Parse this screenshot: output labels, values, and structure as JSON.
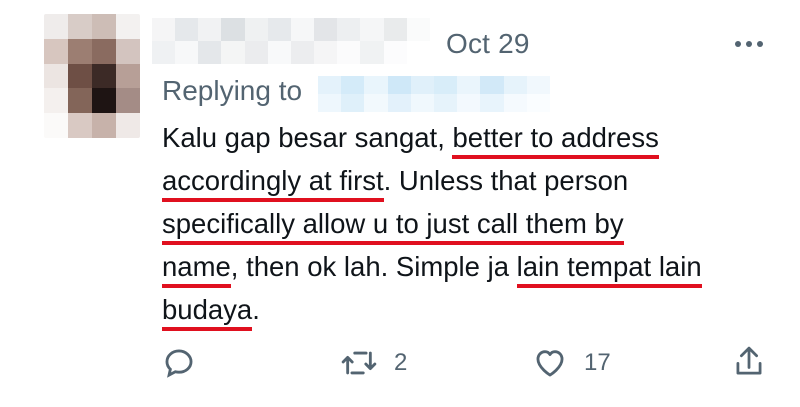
{
  "tweet": {
    "date": "Oct 29",
    "replying_to_label": "Replying to",
    "body_lines": [
      [
        {
          "text": "Kalu gap besar sangat, ",
          "underline": false
        },
        {
          "text": "better to address",
          "underline": true
        }
      ],
      [
        {
          "text": "accordingly at first",
          "underline": true
        },
        {
          "text": ". Unless that person",
          "underline": false
        }
      ],
      [
        {
          "text": "specifically allow u to just call them by",
          "underline": true
        }
      ],
      [
        {
          "text": "name",
          "underline": true
        },
        {
          "text": ", then ok lah. Simple ja ",
          "underline": false
        },
        {
          "text": "lain tempat lain",
          "underline": true
        }
      ],
      [
        {
          "text": "budaya",
          "underline": true
        },
        {
          "text": ".",
          "underline": false
        }
      ]
    ]
  },
  "actions": {
    "reply_icon": "speech-bubble-icon",
    "retweet_icon": "retweet-icon",
    "retweet_count": "2",
    "like_icon": "heart-icon",
    "like_count": "17",
    "share_icon": "share-upload-icon"
  },
  "colors": {
    "text_primary": "#0f1419",
    "text_secondary": "#536471",
    "annotation_underline": "#e0101f"
  }
}
